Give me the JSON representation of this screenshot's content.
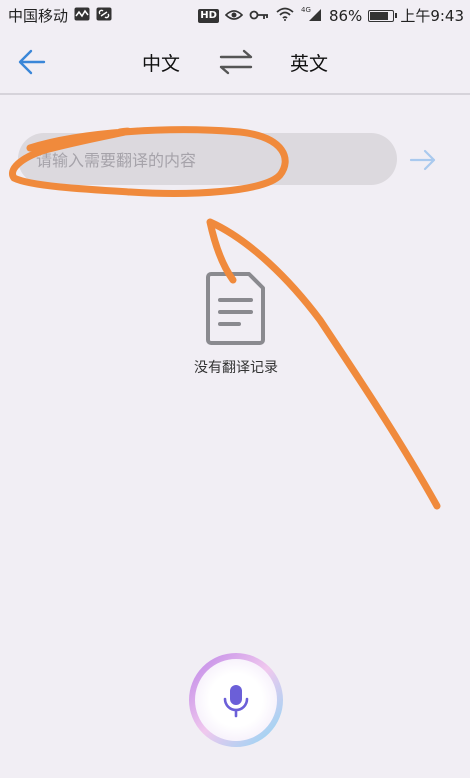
{
  "status_bar": {
    "carrier": "中国移动",
    "battery": "86%",
    "time": "上午9:43",
    "hd": "HD",
    "network": "4G",
    "battery_level": 0.86
  },
  "header": {
    "source_language": "中文",
    "target_language": "英文"
  },
  "input": {
    "placeholder": "请输入需要翻译的内容",
    "value": ""
  },
  "empty_state": {
    "message": "没有翻译记录"
  },
  "colors": {
    "accent": "#3a86d8",
    "background": "#f1eef4",
    "input_bg": "#dcd9de",
    "annotation": "#f08a3c",
    "mic": "#6b5fd8"
  }
}
